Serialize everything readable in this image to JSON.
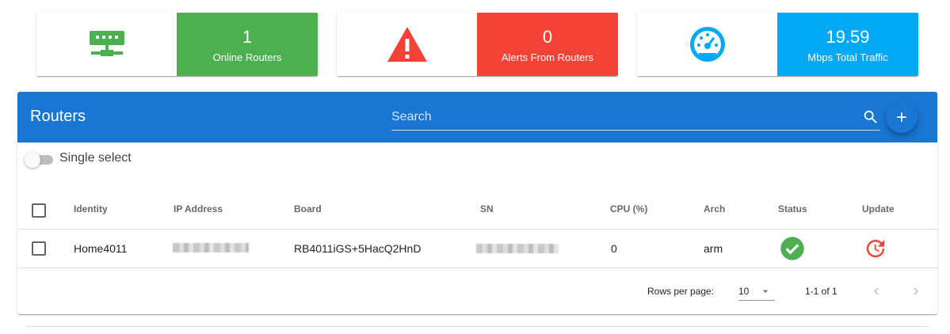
{
  "stats": [
    {
      "value": "1",
      "label": "Online Routers",
      "color": "#4caf50",
      "icon": "router-icon",
      "icon_color": "#4caf50"
    },
    {
      "value": "0",
      "label": "Alerts From Routers",
      "color": "#f44336",
      "icon": "warning-icon",
      "icon_color": "#f44336"
    },
    {
      "value": "19.59",
      "label": "Mbps Total Traffic",
      "color": "#03a9f4",
      "icon": "speedometer-icon",
      "icon_color": "#03a9f4"
    }
  ],
  "routers": {
    "title": "Routers",
    "search_placeholder": "Search",
    "add_icon": "plus-icon",
    "toolbar_color": "#1976d2",
    "single_select_label": "Single select",
    "columns": [
      "Identity",
      "IP Address",
      "Board",
      "SN",
      "CPU (%)",
      "Arch",
      "Status",
      "Update"
    ],
    "rows": [
      {
        "identity": "Home4011",
        "board": "RB4011iGS+5HacQ2HnD",
        "cpu": "0",
        "arch": "arm",
        "status_icon": "check-circle-icon",
        "update_icon": "update-icon"
      }
    ],
    "footer": {
      "rows_per_page_label": "Rows per page:",
      "rows_per_page_value": "10",
      "range": "1-1 of 1"
    }
  }
}
